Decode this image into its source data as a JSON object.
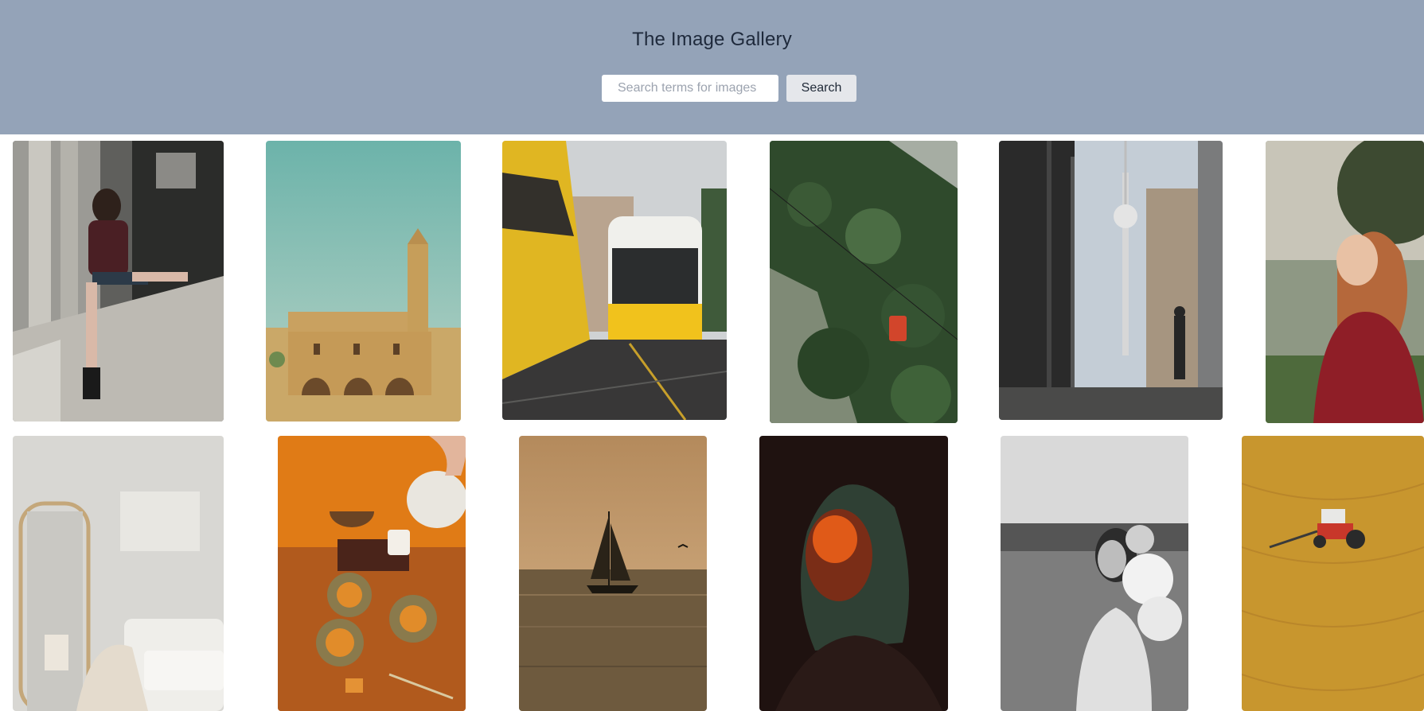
{
  "header": {
    "title": "The Image Gallery",
    "search_placeholder": "Search terms for images",
    "search_value": "",
    "search_button_label": "Search"
  },
  "colors": {
    "header_bg": "#94a3b8",
    "title_text": "#1e293b",
    "search_button_bg": "#e5e7eb"
  },
  "gallery": {
    "images": [
      {
        "name": "woman-sitting-concrete-wall"
      },
      {
        "name": "sandstone-church-with-tower"
      },
      {
        "name": "yellow-trams-city-street"
      },
      {
        "name": "red-cable-car-forest-mountain"
      },
      {
        "name": "berlin-tv-tower-street"
      },
      {
        "name": "woman-red-coat-portrait"
      },
      {
        "name": "white-room-floor-mirror"
      },
      {
        "name": "tea-pouring-mooncakes"
      },
      {
        "name": "sailboat-sepia-sea"
      },
      {
        "name": "woman-orange-light-dark"
      },
      {
        "name": "woman-flowers-black-white"
      },
      {
        "name": "tractor-golden-field"
      }
    ]
  }
}
